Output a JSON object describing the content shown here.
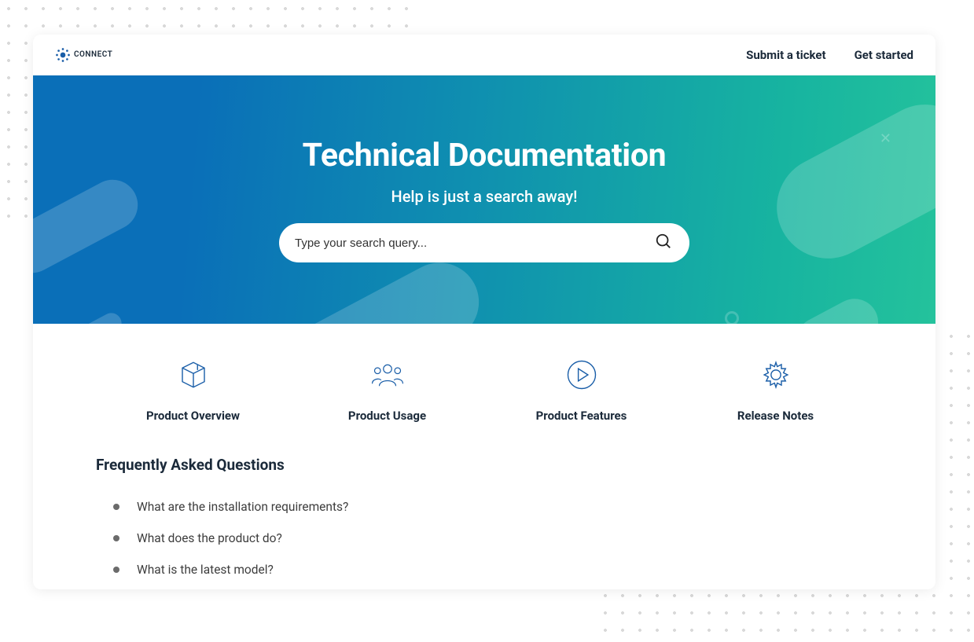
{
  "header": {
    "logo_text": "CONNECT",
    "nav": {
      "submit_ticket": "Submit a ticket",
      "get_started": "Get started"
    }
  },
  "hero": {
    "title": "Technical Documentation",
    "subtitle": "Help is just a search away!",
    "search_placeholder": "Type your search query..."
  },
  "categories": [
    {
      "icon": "package-icon",
      "label": "Product Overview"
    },
    {
      "icon": "people-icon",
      "label": "Product Usage"
    },
    {
      "icon": "play-icon",
      "label": "Product Features"
    },
    {
      "icon": "gear-icon",
      "label": "Release Notes"
    }
  ],
  "faq": {
    "heading": "Frequently Asked Questions",
    "items": [
      "What are the installation requirements?",
      "What does the product do?",
      "What is the latest model?"
    ]
  },
  "colors": {
    "hero_gradient_start": "#0a6fb8",
    "hero_gradient_end": "#24c29c",
    "icon_stroke": "#1a5ea8",
    "text_dark": "#1b2a3a"
  }
}
